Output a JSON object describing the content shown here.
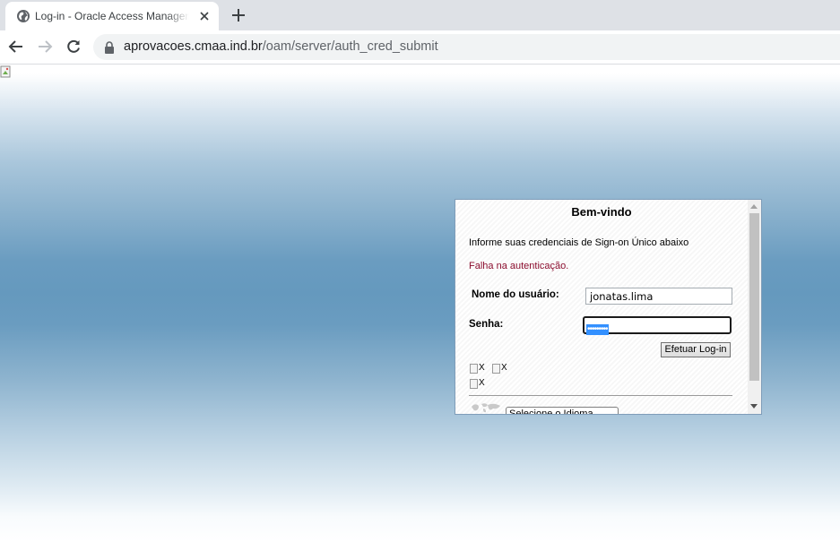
{
  "browser": {
    "tab_title": "Log-in - Oracle Access Management",
    "url_host": "aprovacoes.cmaa.ind.br",
    "url_path": "/oam/server/auth_cred_submit",
    "icons": [
      "globe-icon",
      "close-icon",
      "plus-icon",
      "back-arrow-icon",
      "forward-arrow-icon",
      "reload-icon",
      "lock-icon"
    ]
  },
  "login": {
    "welcome": "Bem-vindo",
    "instructions": "Informe suas credenciais de Sign-on Único abaixo",
    "error": "Falha na autenticação.",
    "username_label": "Nome do usuário:",
    "username_value": "jonatas.lima",
    "password_label": "Senha:",
    "password_value": "•••••••••",
    "login_button": "Efetuar Log-in",
    "broken_images": [
      "X",
      "X",
      "X"
    ],
    "language_select": "Selecione o Idioma"
  },
  "colors": {
    "error_text": "#8b0d2e",
    "selection": "#3390ff",
    "page_blue": "#6599be"
  }
}
